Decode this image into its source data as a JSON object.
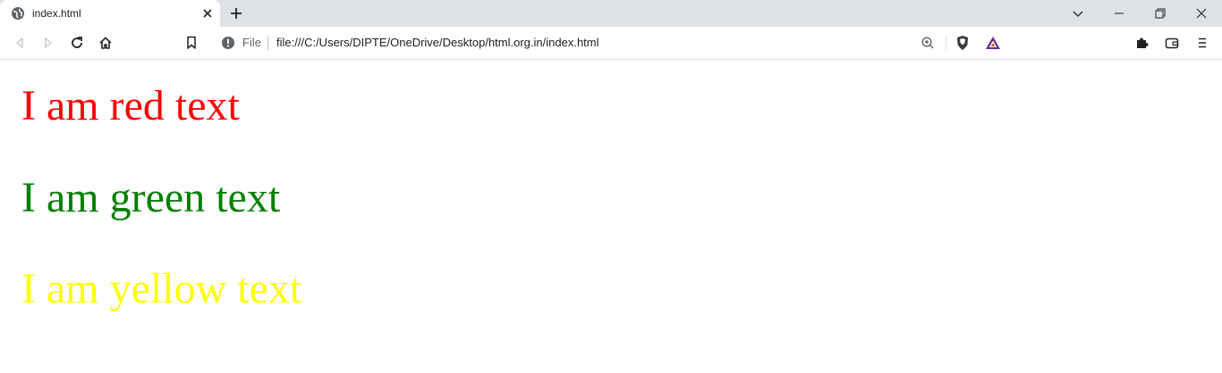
{
  "browser": {
    "tab": {
      "title": "index.html",
      "favicon": "globe-icon",
      "close_icon": "close-icon"
    },
    "new_tab_icon": "plus-icon",
    "window_controls": [
      "chevron-down-icon",
      "minimize-icon",
      "restore-icon",
      "close-icon"
    ],
    "toolbar": {
      "back_icon": "back-arrow-icon",
      "forward_icon": "forward-arrow-icon",
      "reload_icon": "reload-icon",
      "home_icon": "home-icon",
      "bookmark_icon": "bookmark-icon"
    },
    "omnibox": {
      "info_icon": "info-icon",
      "scheme_label": "File",
      "url": "file:///C:/Users/DIPTE/OneDrive/Desktop/html.org.in/index.html",
      "zoom_icon": "zoom-icon",
      "brave_icon": "brave-shield-icon",
      "rewards_icon": "bat-rewards-icon"
    },
    "extensions_icon": "puzzle-icon",
    "wallet_icon": "wallet-icon",
    "menu_icon": "hamburger-menu-icon"
  },
  "page": {
    "lines": [
      {
        "text": "I am red text",
        "color": "#ff0000"
      },
      {
        "text": "I am green text",
        "color": "#008000"
      },
      {
        "text": "I am yellow text",
        "color": "#ffff00"
      }
    ]
  }
}
